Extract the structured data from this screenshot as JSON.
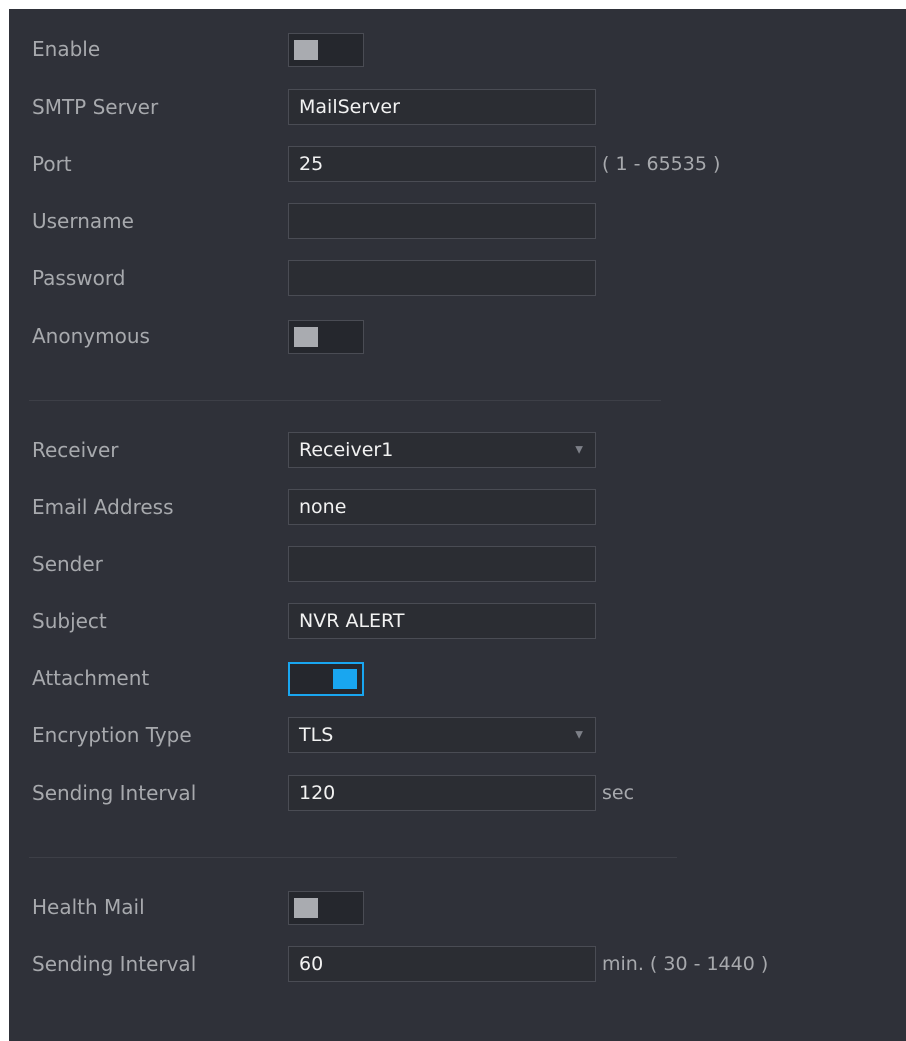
{
  "smtp": {
    "enable": {
      "label": "Enable",
      "on": false
    },
    "server": {
      "label": "SMTP Server",
      "value": "MailServer"
    },
    "port": {
      "label": "Port",
      "value": "25",
      "range": "( 1 - 65535 )"
    },
    "username": {
      "label": "Username",
      "value": ""
    },
    "password": {
      "label": "Password",
      "value": ""
    },
    "anonymous": {
      "label": "Anonymous",
      "on": false
    }
  },
  "mail": {
    "receiver": {
      "label": "Receiver",
      "value": "Receiver1"
    },
    "email_address": {
      "label": "Email Address",
      "value": "none"
    },
    "sender": {
      "label": "Sender",
      "value": ""
    },
    "subject": {
      "label": "Subject",
      "value": "NVR ALERT"
    },
    "attachment": {
      "label": "Attachment",
      "on": true
    },
    "encryption_type": {
      "label": "Encryption Type",
      "value": "TLS"
    },
    "sending_interval": {
      "label": "Sending Interval",
      "value": "120",
      "unit": "sec"
    }
  },
  "health": {
    "health_mail": {
      "label": "Health Mail",
      "on": false
    },
    "sending_interval": {
      "label": "Sending Interval",
      "value": "60",
      "unit": "min. ( 30 - 1440 )"
    }
  },
  "colors": {
    "background": "#2f3139",
    "accent": "#19a6f0",
    "label": "#a7a9ad",
    "value": "#f2f2f2"
  }
}
